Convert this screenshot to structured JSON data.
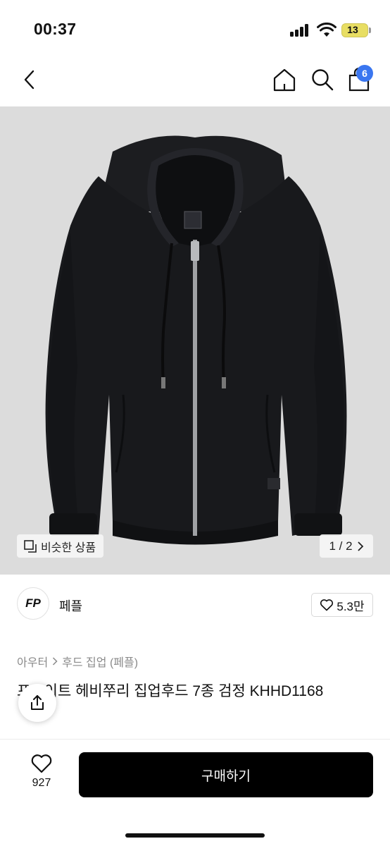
{
  "status": {
    "time": "00:37",
    "battery": "13"
  },
  "header": {
    "back_icon": "chevron-left-icon",
    "home_icon": "home-icon",
    "search_icon": "search-icon",
    "cart_icon": "shopping-bag-icon",
    "cart_count": "6",
    "badge_color": "#3a76f0"
  },
  "gallery": {
    "similar_label": "비슷한 상품",
    "page_indicator": "1 / 2",
    "background": "#dcdcdc"
  },
  "seller": {
    "logo_text": "FP",
    "name": "페플",
    "likes": "5.3만"
  },
  "breadcrumb": {
    "level1": "아우터",
    "level2": "후드 집업 (페플)"
  },
  "product": {
    "title": "프로이트 헤비쭈리 집업후드 7종 검정 KHHD1168"
  },
  "bottom": {
    "wish_count": "927",
    "buy_label": "구매하기"
  }
}
